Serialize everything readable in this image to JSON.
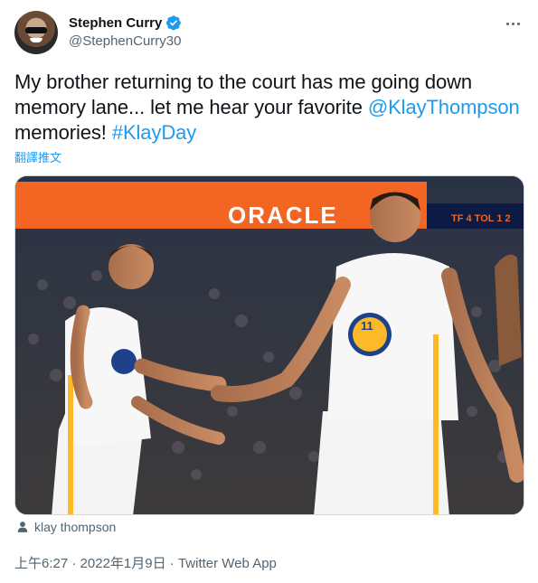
{
  "author": {
    "display_name": "Stephen Curry",
    "handle": "@StephenCurry30",
    "verified": true,
    "avatar_icon": "avatar-photo"
  },
  "tweet": {
    "text_part1": "My brother returning to the court has me going down memory lane... let me hear your favorite ",
    "mention": "@KlayThompson",
    "text_part2": " memories! ",
    "hashtag": "#KlayDay",
    "translate_label": "翻譯推文"
  },
  "media": {
    "arena_sign": "ORACLE",
    "jersey_number": "11",
    "scoreboard": "TF 4 TOL 1 2"
  },
  "tagged_user": "klay thompson",
  "meta": {
    "time": "上午6:27",
    "separator1": " · ",
    "date": "2022年1月9日",
    "separator2": " · ",
    "source": "Twitter Web App"
  },
  "colors": {
    "link": "#1d9bf0",
    "secondary_text": "#536471",
    "oracle_orange": "#f26522",
    "jersey_blue": "#1d428a",
    "jersey_gold": "#fdb927"
  }
}
